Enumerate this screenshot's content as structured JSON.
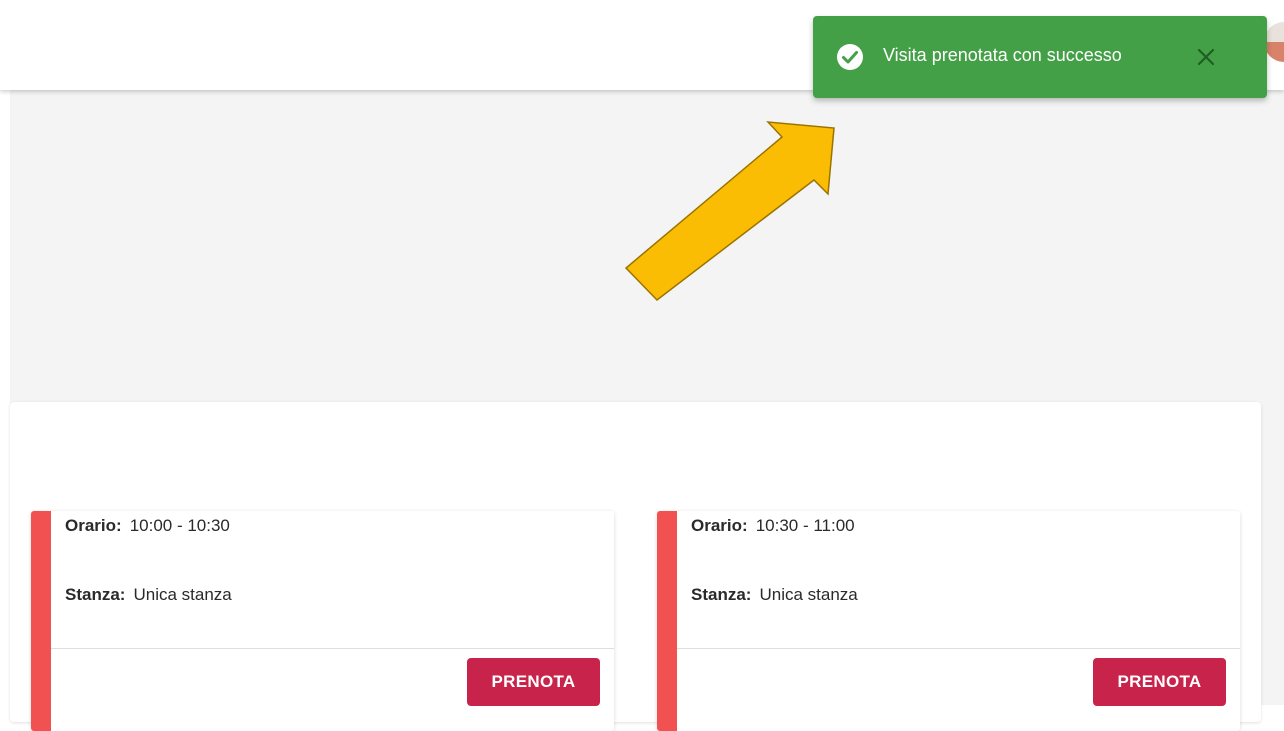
{
  "toast": {
    "message": "Visita prenotata con successo",
    "icon": "check-circle-icon",
    "close_icon": "close-icon",
    "color": "#43a047"
  },
  "slots": [
    {
      "time_label": "Orario:",
      "time_value": "10:00 - 10:30",
      "room_label": "Stanza:",
      "room_value": "Unica stanza",
      "button_label": "PRENOTA"
    },
    {
      "time_label": "Orario:",
      "time_value": "10:30 - 11:00",
      "room_label": "Stanza:",
      "room_value": "Unica stanza",
      "button_label": "PRENOTA"
    }
  ],
  "colors": {
    "accent_bar": "#f25152",
    "book_button": "#c8234a",
    "annotation_arrow": "#fbbd04"
  }
}
